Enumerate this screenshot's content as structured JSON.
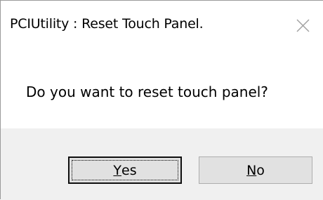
{
  "window": {
    "title": "PCIUtility : Reset Touch Panel.",
    "close_icon": "close-icon"
  },
  "message": {
    "text": "Do you want to reset touch panel?"
  },
  "buttons": {
    "yes": {
      "mnemonic": "Y",
      "rest": "es"
    },
    "no": {
      "mnemonic": "N",
      "rest": "o"
    }
  }
}
